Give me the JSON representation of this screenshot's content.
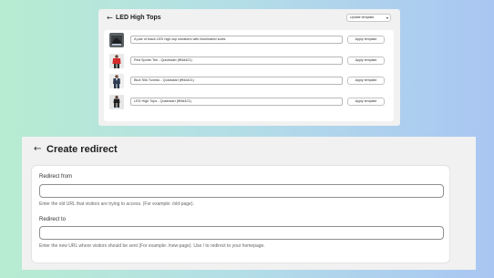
{
  "template_page": {
    "back_label": "←",
    "title": "LED High Tops",
    "update_button": {
      "label": "Update template",
      "icon": "chevron-down-icon"
    },
    "rows": [
      {
        "thumbnail": "sneakers-photo",
        "title": "A pair of black LED high-top sneakers with illuminated soles",
        "apply_label": "Apply template"
      },
      {
        "thumbnail": "red-tee-photo",
        "title": "Red Sports Tee - Quickstart (fff4d421)",
        "apply_label": "Apply template"
      },
      {
        "thumbnail": "tuxedo-photo",
        "title": "Blue Silk Tuxedo - Quickstart (fff4d421)",
        "apply_label": "Apply template"
      },
      {
        "thumbnail": "high-tops-photo",
        "title": "LED High Tops - Quickstart (fff4d421)",
        "apply_label": "Apply template"
      }
    ]
  },
  "redirect_page": {
    "back_label": "←",
    "title": "Create redirect",
    "redirect_from": {
      "label": "Redirect from",
      "value": "",
      "help": "Enter the old URL that visitors are trying to access. (For example: /old-page)."
    },
    "redirect_to": {
      "label": "Redirect to",
      "value": "",
      "help": "Enter the new URL where visitors should be sent (For example: /new-page). Use / to redirect to your homepage."
    }
  }
}
